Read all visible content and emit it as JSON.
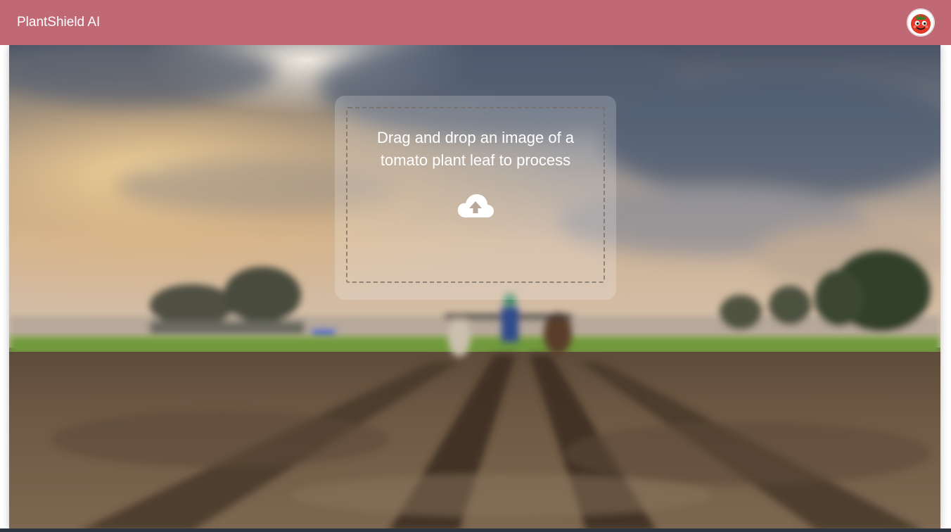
{
  "header": {
    "title": "PlantShield AI",
    "avatar_icon": "tomato-mascot-icon"
  },
  "upload": {
    "prompt": "Drag and drop an image of a tomato plant leaf to process",
    "icon": "cloud-upload-icon"
  },
  "colors": {
    "header_bg": "#c06874",
    "text": "#ffffff",
    "tomato_red": "#e23a2a"
  }
}
